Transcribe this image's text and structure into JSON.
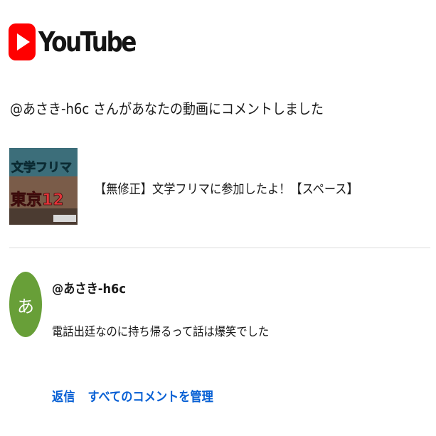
{
  "brand": {
    "name": "YouTube",
    "icon": "youtube-play-icon",
    "color": "#ff0000"
  },
  "notification": {
    "headline": "@あさき-h6c さんがあなたの動画にコメントしました"
  },
  "video": {
    "title": "【無修正】文学フリマに参加したよ！【スペース】",
    "thumbnail_text_top": "文学フリマ",
    "thumbnail_text_bottom": "東京12"
  },
  "comment": {
    "avatar_letter": "あ",
    "avatar_color": "#689f38",
    "author": "@あさき-h6c",
    "text": "電話出廷なのに持ち帰るって話は爆笑でした"
  },
  "actions": {
    "reply_label": "返信",
    "manage_label": "すべてのコメントを管理",
    "link_color": "#065fd4"
  }
}
